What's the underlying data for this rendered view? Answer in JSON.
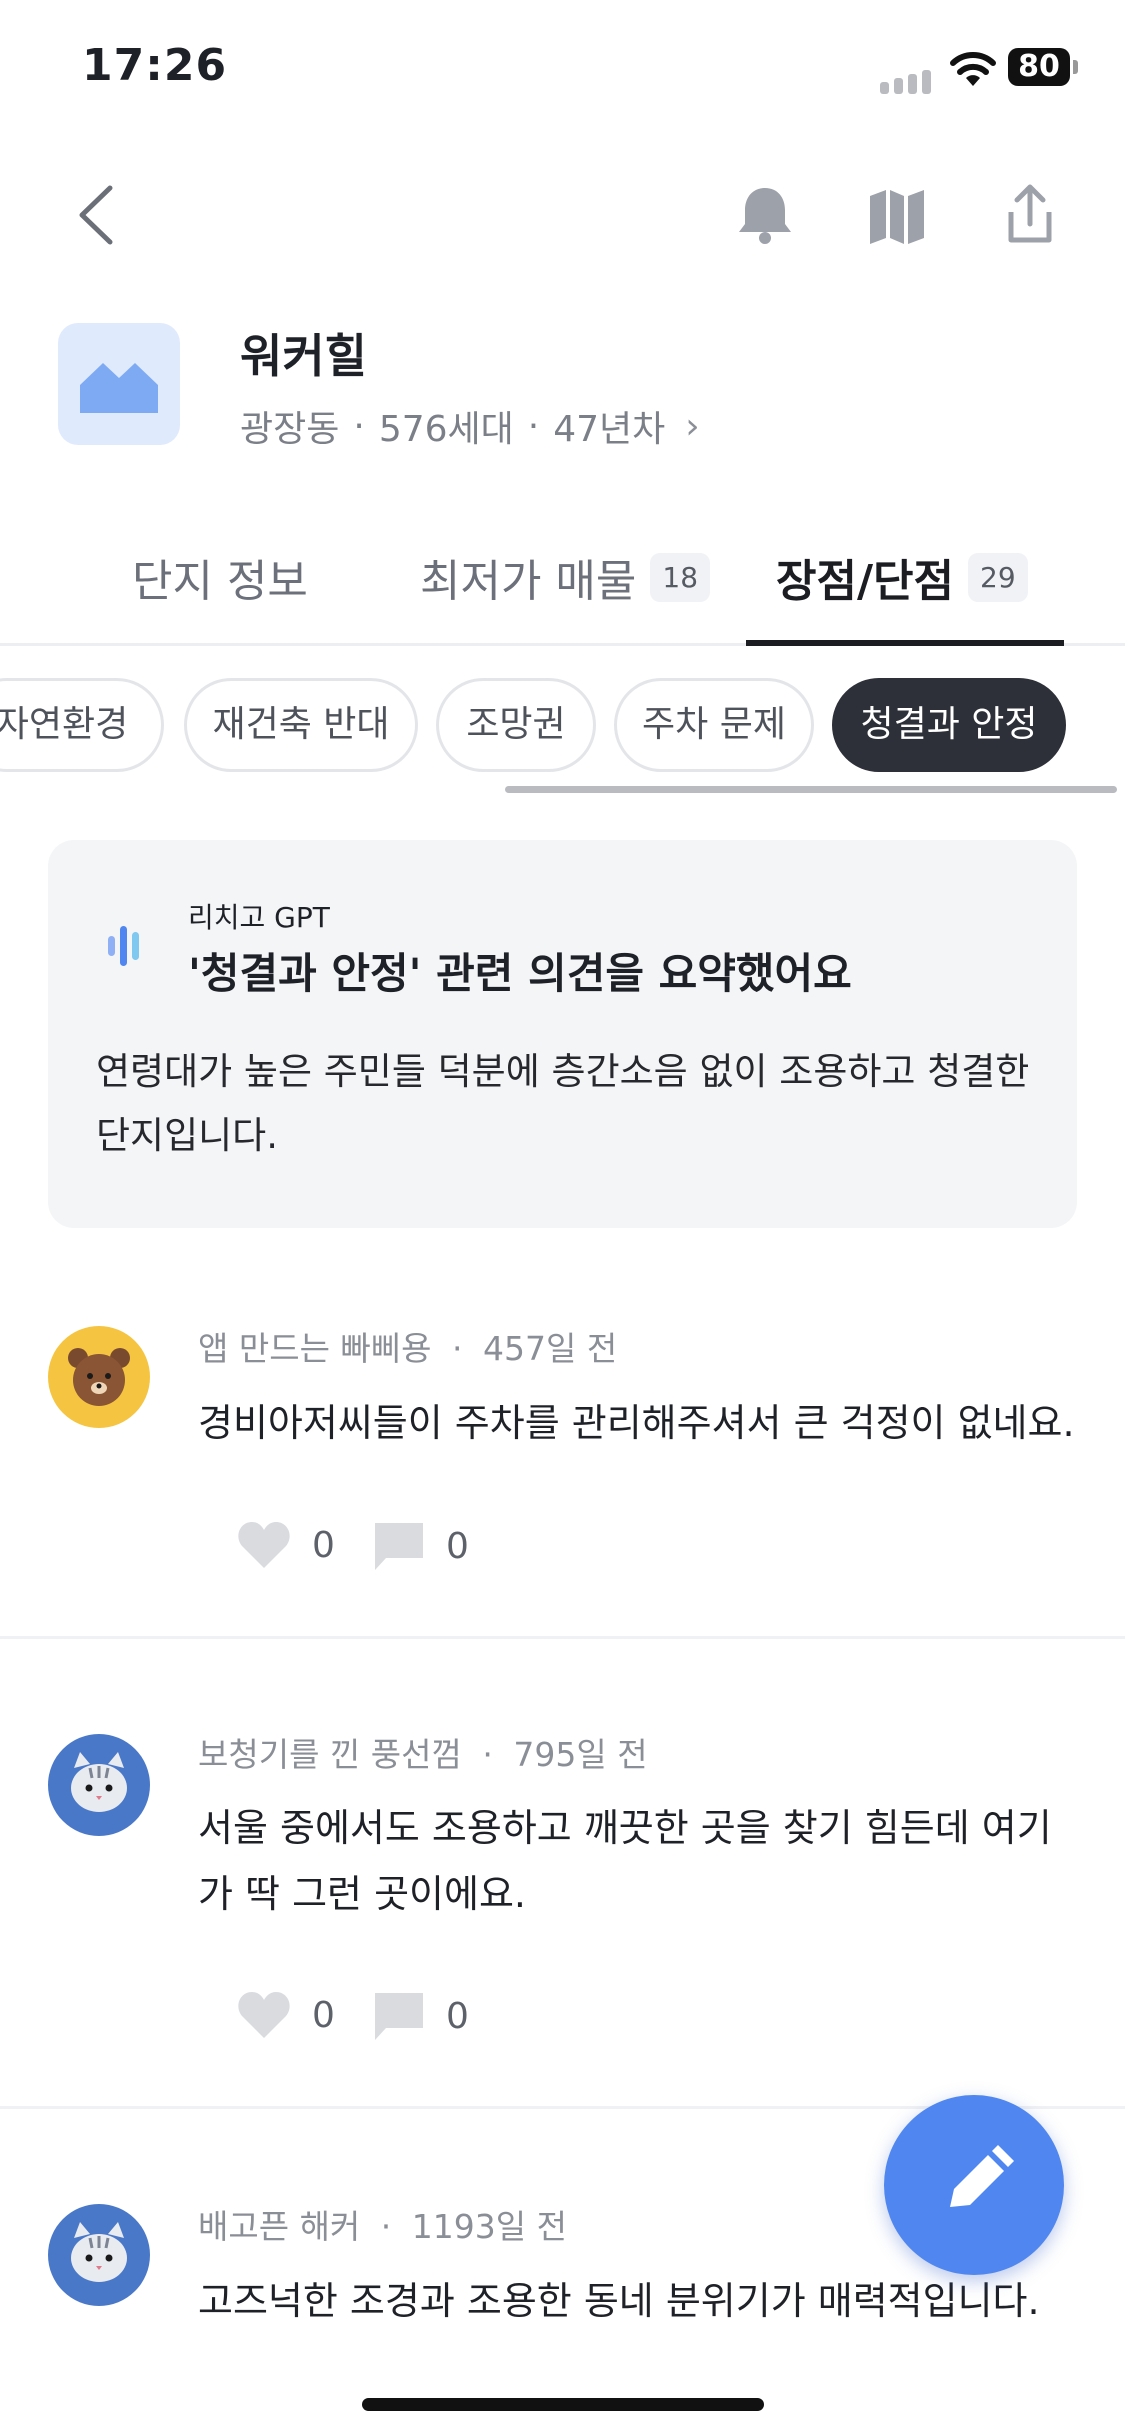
{
  "status": {
    "time": "17:26",
    "battery": "80"
  },
  "header": {
    "back_icon": "chevron-left-icon",
    "icons": [
      "bell-icon",
      "map-icon",
      "share-icon"
    ]
  },
  "complex": {
    "name": "워커힐",
    "district": "광장동",
    "households": "576세대",
    "age": "47년차",
    "dot": "·",
    "chevron": "›"
  },
  "tabs": [
    {
      "label": "단지 정보",
      "badge": ""
    },
    {
      "label": "최저가 매물",
      "badge": "18"
    },
    {
      "label": "장점/단점",
      "badge": "29"
    }
  ],
  "chips": [
    "자연환경",
    "재건축 반대",
    "조망권",
    "주차 문제",
    "청결과 안정"
  ],
  "active_chip": "청결과 안정",
  "summary": {
    "source": "리치고 GPT",
    "title": "'청결과 안정' 관련 의견을 요약했어요",
    "text": "연령대가 높은 주민들 덕분에 층간소음 없이 조용하고 청결한 단지입니다."
  },
  "reviews": [
    {
      "author": "앱 만드는 빠삐용",
      "time": "457일 전",
      "text": "경비아저씨들이 주차를 관리해주셔서 큰 걱정이 없네요.",
      "likes": "0",
      "comments": "0",
      "avatar": "bear-avatar"
    },
    {
      "author": "보청기를 낀 풍선껌",
      "time": "795일 전",
      "text": "서울 중에서도 조용하고 깨끗한 곳을 찾기 힘든데 여기가 딱 그런 곳이에요.",
      "likes": "0",
      "comments": "0",
      "avatar": "cat-avatar"
    },
    {
      "author": "배고픈 해커",
      "time": "1193일 전",
      "text": "고즈넉한 조경과 조용한 동네 분위기가 매력적입니다.",
      "likes": "0",
      "comments": "0",
      "avatar": "cat-avatar"
    }
  ],
  "fab": {
    "icon": "pencil-icon"
  },
  "colors": {
    "accent": "#4f86ef",
    "chip_active": "#2d3038",
    "card_bg": "#f4f5f7"
  }
}
